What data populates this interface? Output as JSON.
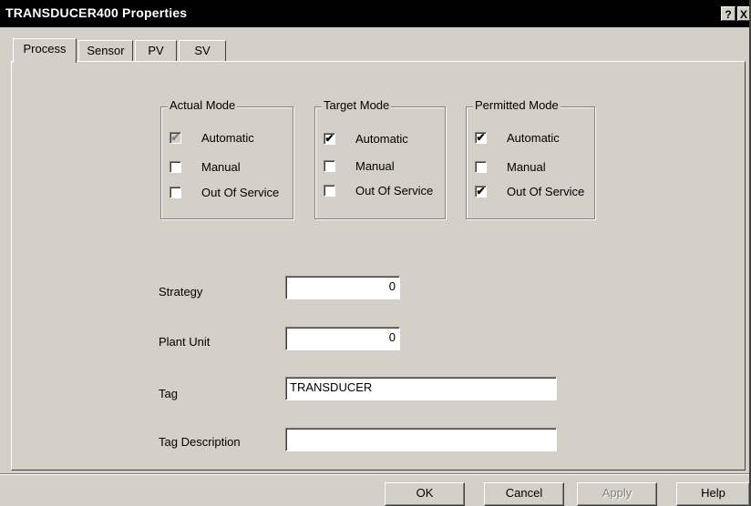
{
  "window": {
    "title": "TRANSDUCER400 Properties",
    "help_glyph": "?",
    "close_glyph": "X"
  },
  "tabs": [
    {
      "label": "Process",
      "active": true
    },
    {
      "label": "Sensor",
      "active": false
    },
    {
      "label": "PV",
      "active": false
    },
    {
      "label": "SV",
      "active": false
    }
  ],
  "mode_groups": [
    {
      "title": "Actual Mode",
      "options": [
        {
          "label": "Automatic",
          "checked": true,
          "enabled": false
        },
        {
          "label": "Manual",
          "checked": false,
          "enabled": true
        },
        {
          "label": "Out Of Service",
          "checked": false,
          "enabled": true
        }
      ]
    },
    {
      "title": "Target Mode",
      "options": [
        {
          "label": "Automatic",
          "checked": true,
          "enabled": true
        },
        {
          "label": "Manual",
          "checked": false,
          "enabled": true
        },
        {
          "label": "Out Of Service",
          "checked": false,
          "enabled": true
        }
      ]
    },
    {
      "title": "Permitted Mode",
      "options": [
        {
          "label": "Automatic",
          "checked": true,
          "enabled": true
        },
        {
          "label": "Manual",
          "checked": false,
          "enabled": true
        },
        {
          "label": "Out Of Service",
          "checked": true,
          "enabled": true
        }
      ]
    }
  ],
  "fields": {
    "strategy": {
      "label": "Strategy",
      "value": "0"
    },
    "plant_unit": {
      "label": "Plant Unit",
      "value": "0"
    },
    "tag": {
      "label": "Tag",
      "value": "TRANSDUCER"
    },
    "tag_description": {
      "label": "Tag Description",
      "value": ""
    }
  },
  "buttons": {
    "ok": "OK",
    "cancel": "Cancel",
    "apply": "Apply",
    "help": "Help"
  },
  "check_glyph": "✔"
}
